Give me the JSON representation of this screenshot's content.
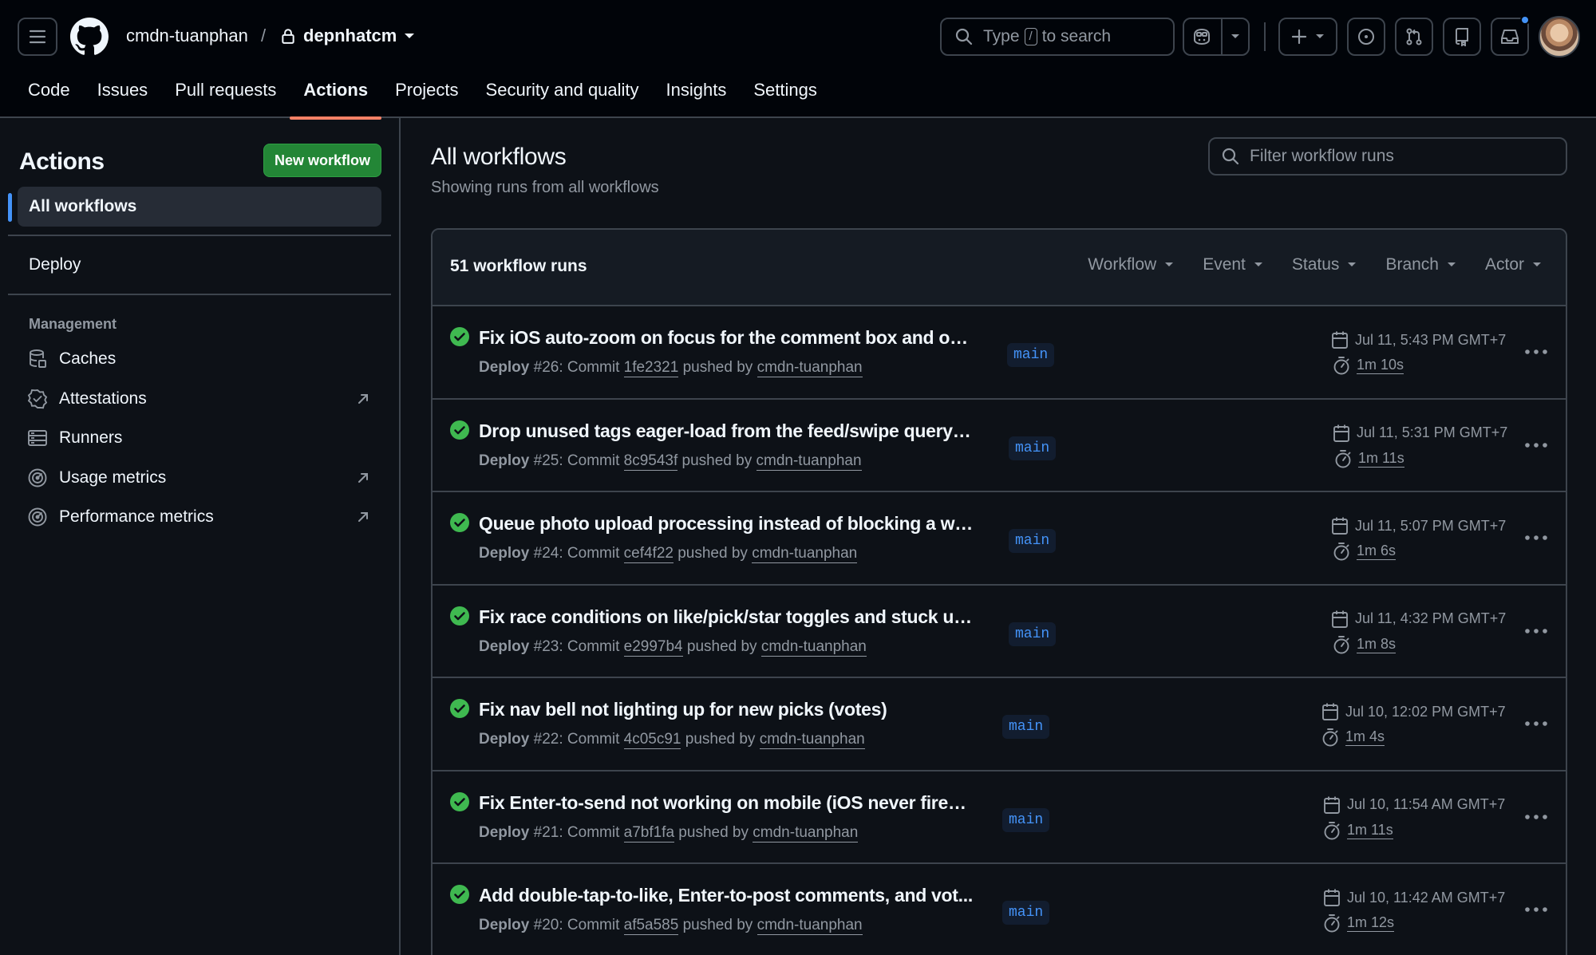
{
  "header": {
    "owner": "cmdn-tuanphan",
    "separator": "/",
    "repo": "depnhatcm",
    "search_prefix": "Type",
    "search_key": "/",
    "search_suffix": "to search"
  },
  "repo_tabs": [
    "Code",
    "Issues",
    "Pull requests",
    "Actions",
    "Projects",
    "Security and quality",
    "Insights",
    "Settings"
  ],
  "active_tab": "Actions",
  "sidebar": {
    "title": "Actions",
    "new_workflow": "New workflow",
    "all_workflows": "All workflows",
    "workflows": [
      "Deploy"
    ],
    "management_heading": "Management",
    "management_items": [
      {
        "label": "Caches",
        "icon": "database-icon",
        "external": false
      },
      {
        "label": "Attestations",
        "icon": "verified-icon",
        "external": true
      },
      {
        "label": "Runners",
        "icon": "server-icon",
        "external": false
      },
      {
        "label": "Usage metrics",
        "icon": "meter-icon",
        "external": true
      },
      {
        "label": "Performance metrics",
        "icon": "meter-icon",
        "external": true
      }
    ]
  },
  "main": {
    "title": "All workflows",
    "subtitle": "Showing runs from all workflows",
    "filter_placeholder": "Filter workflow runs",
    "run_count": "51 workflow runs",
    "filters": [
      "Workflow",
      "Event",
      "Status",
      "Branch",
      "Actor"
    ]
  },
  "runs": [
    {
      "title": "Fix iOS auto-zoom on focus for the comment box and othe...",
      "workflow": "Deploy",
      "number": "#26",
      "commit": "1fe2321",
      "pusher": "cmdn-tuanphan",
      "branch": "main",
      "date": "Jul 11, 5:43 PM GMT+7",
      "duration": "1m 10s",
      "status": "success"
    },
    {
      "title": "Drop unused tags eager-load from the feed/swipe query p...",
      "workflow": "Deploy",
      "number": "#25",
      "commit": "8c9543f",
      "pusher": "cmdn-tuanphan",
      "branch": "main",
      "date": "Jul 11, 5:31 PM GMT+7",
      "duration": "1m 11s",
      "status": "success"
    },
    {
      "title": "Queue photo upload processing instead of blocking a web...",
      "workflow": "Deploy",
      "number": "#24",
      "commit": "cef4f22",
      "pusher": "cmdn-tuanphan",
      "branch": "main",
      "date": "Jul 11, 5:07 PM GMT+7",
      "duration": "1m 6s",
      "status": "success"
    },
    {
      "title": "Fix race conditions on like/pick/star toggles and stuck uplo...",
      "workflow": "Deploy",
      "number": "#23",
      "commit": "e2997b4",
      "pusher": "cmdn-tuanphan",
      "branch": "main",
      "date": "Jul 11, 4:32 PM GMT+7",
      "duration": "1m 8s",
      "status": "success"
    },
    {
      "title": "Fix nav bell not lighting up for new picks (votes)",
      "workflow": "Deploy",
      "number": "#22",
      "commit": "4c05c91",
      "pusher": "cmdn-tuanphan",
      "branch": "main",
      "date": "Jul 10, 12:02 PM GMT+7",
      "duration": "1m 4s",
      "status": "success"
    },
    {
      "title": "Fix Enter-to-send not working on mobile (iOS never fires k...",
      "workflow": "Deploy",
      "number": "#21",
      "commit": "a7bf1fa",
      "pusher": "cmdn-tuanphan",
      "branch": "main",
      "date": "Jul 10, 11:54 AM GMT+7",
      "duration": "1m 11s",
      "status": "success"
    },
    {
      "title": "Add double-tap-to-like, Enter-to-post comments, and vot...",
      "workflow": "Deploy",
      "number": "#20",
      "commit": "af5a585",
      "pusher": "cmdn-tuanphan",
      "branch": "main",
      "date": "Jul 10, 11:42 AM GMT+7",
      "duration": "1m 12s",
      "status": "success"
    }
  ],
  "colors": {
    "background": "#0d1117",
    "header": "#010409",
    "border": "#3d444d",
    "accent_tab": "#f78166",
    "success": "#3fb950",
    "primary_button": "#238636",
    "branch_text": "#4493f8"
  }
}
